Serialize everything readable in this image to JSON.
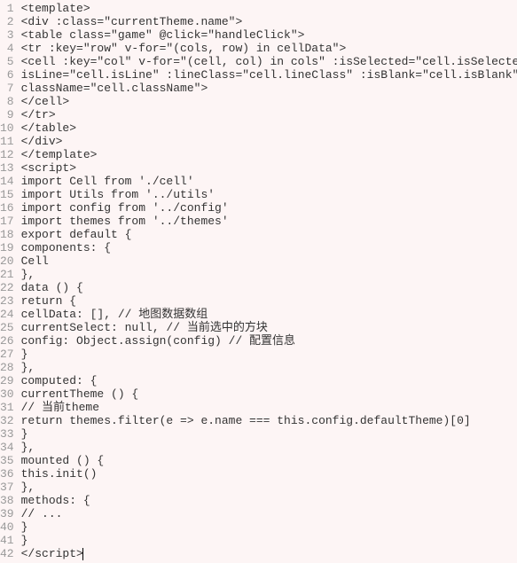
{
  "lines": [
    "<template>",
    "<div :class=\"currentTheme.name\">",
    "<table class=\"game\" @click=\"handleClick\">",
    "<tr :key=\"row\" v-for=\"(cols, row) in cellData\">",
    "<cell :key=\"col\" v-for=\"(cell, col) in cols\" :isSelected=\"cell.isSelected\" :",
    "isLine=\"cell.isLine\" :lineClass=\"cell.lineClass\" :isBlank=\"cell.isBlank\" :",
    "className=\"cell.className\">",
    "</cell>",
    "</tr>",
    "</table>",
    "</div>",
    "</template>",
    "<script>",
    "import Cell from './cell'",
    "import Utils from '../utils'",
    "import config from '../config'",
    "import themes from '../themes'",
    "export default {",
    "components: {",
    "Cell",
    "},",
    "data () {",
    "return {",
    "cellData: [], // 地图数据数组",
    "currentSelect: null, // 当前选中的方块",
    "config: Object.assign(config) // 配置信息",
    "}",
    "},",
    "computed: {",
    "currentTheme () {",
    "// 当前theme",
    "return themes.filter(e => e.name === this.config.defaultTheme)[0]",
    "}",
    "},",
    "mounted () {",
    "this.init()",
    "},",
    "methods: {",
    "// ...",
    "}",
    "}",
    "</script>"
  ],
  "cursorLine": 42
}
